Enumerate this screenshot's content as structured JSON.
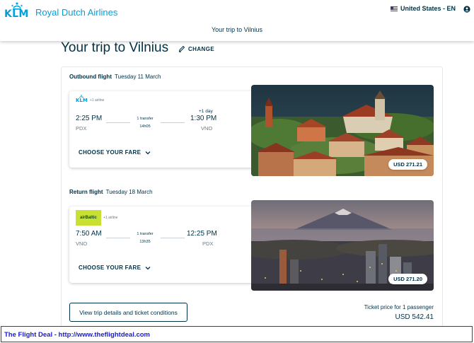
{
  "header": {
    "logo_word": "KLM",
    "logo_text": "Royal Dutch Airlines",
    "country": "United States - EN",
    "subtitle": "Your trip to Vilnius"
  },
  "page": {
    "title": "Your trip to Vilnius",
    "change_label": "CHANGE"
  },
  "outbound": {
    "label": "Outbound flight",
    "date": "Tuesday 11 March",
    "airline_logo": "KLM",
    "airline_extra": "+1 airline",
    "depart_time": "2:25 PM",
    "depart_code": "PDX",
    "transfer": "1 transfer",
    "duration": "14h05",
    "plus_day": "+1 day",
    "arrive_time": "1:30 PM",
    "arrive_code": "VNO",
    "fare_label": "CHOOSE YOUR FARE",
    "price": "USD 271.21"
  },
  "return": {
    "label": "Return flight",
    "date": "Tuesday 18 March",
    "airline_logo": "airBaltic",
    "airline_extra": "+1 airline",
    "depart_time": "7:50 AM",
    "depart_code": "VNO",
    "transfer": "1 transfer",
    "duration": "13h35",
    "arrive_time": "12:25 PM",
    "arrive_code": "PDX",
    "fare_label": "CHOOSE YOUR FARE",
    "price": "USD 271.20"
  },
  "summary": {
    "details_button": "View trip details and ticket conditions",
    "ticket_label": "Ticket price for 1 passenger",
    "ticket_price": "USD 542.41"
  },
  "footer": {
    "text": "The Flight Deal - http://www.theflightdeal.com"
  },
  "colors": {
    "brand_blue": "#00a1de",
    "navy": "#003145",
    "footer_border": "#e0000a",
    "footer_text": "#1a1ad6",
    "airbaltic_green": "#c8e034"
  },
  "icons": [
    "klm-crown-icon",
    "us-flag-icon",
    "user-icon",
    "pencil-icon",
    "chevron-down-icon"
  ]
}
